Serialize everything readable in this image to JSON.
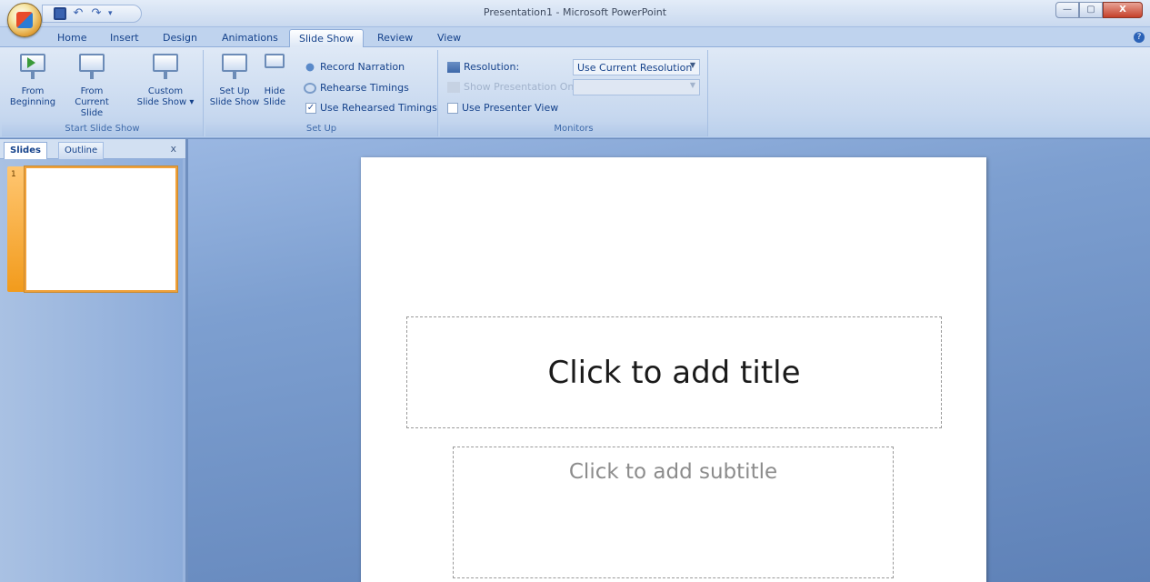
{
  "window": {
    "title": "Presentation1 - Microsoft PowerPoint",
    "controls": {
      "minimize": "—",
      "maximize": "▢",
      "close": "X"
    }
  },
  "ribbon_tabs": [
    "Home",
    "Insert",
    "Design",
    "Animations",
    "Slide Show",
    "Review",
    "View"
  ],
  "active_tab": "Slide Show",
  "help_label": "?",
  "groups": {
    "start_slide_show": {
      "label": "Start Slide Show",
      "from_beginning": [
        "From",
        "Beginning"
      ],
      "from_current": [
        "From",
        "Current Slide"
      ],
      "custom": [
        "Custom",
        "Slide Show ▾"
      ]
    },
    "set_up": {
      "label": "Set Up",
      "set_up_show": [
        "Set Up",
        "Slide Show"
      ],
      "hide_slide": [
        "Hide",
        "Slide"
      ],
      "record_narration": "Record Narration",
      "rehearse_timings": "Rehearse Timings",
      "use_rehearsed": "Use Rehearsed Timings",
      "use_rehearsed_checked": "✓"
    },
    "monitors": {
      "label": "Monitors",
      "resolution_label": "Resolution:",
      "resolution_value": "Use Current Resolution",
      "show_on_label": "Show Presentation On:",
      "show_on_value": "",
      "presenter_view": "Use Presenter View",
      "presenter_view_checked": ""
    }
  },
  "pane": {
    "tabs": [
      "Slides",
      "Outline"
    ],
    "close": "x",
    "slide_number": "1"
  },
  "slide": {
    "title_placeholder": "Click to add title",
    "subtitle_placeholder": "Click to add subtitle"
  }
}
